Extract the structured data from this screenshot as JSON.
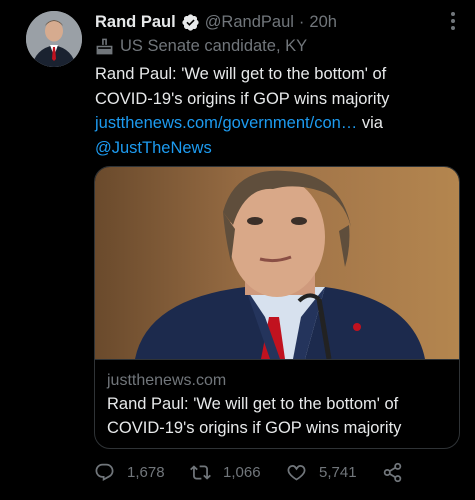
{
  "author": {
    "name": "Rand Paul",
    "handle": "@RandPaul",
    "separator": "·",
    "time": "20h",
    "verified": true,
    "label_icon": "ballot-box-icon",
    "label": "US Senate candidate, KY"
  },
  "tweet": {
    "text_line1": "Rand Paul: 'We will get to the bottom' of",
    "text_line2": "COVID-19's origins if GOP wins majority",
    "link": "justthenews.com/government/con…",
    "via": " via",
    "mention": "@JustTheNews"
  },
  "card": {
    "domain": "justthenews.com",
    "title_line1": "Rand Paul: 'We will get to the bottom' of",
    "title_line2": "COVID-19's origins if GOP wins majority"
  },
  "actions": {
    "replies": "1,678",
    "retweets": "1,066",
    "likes": "5,741"
  },
  "colors": {
    "background": "#000000",
    "text": "#e7e9ea",
    "secondary": "#71767b",
    "link": "#1d9bf0",
    "border": "#2f3336"
  }
}
